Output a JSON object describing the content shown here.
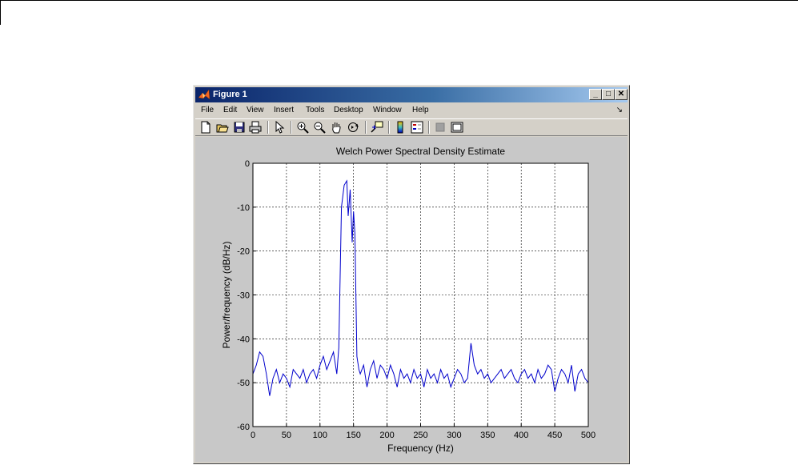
{
  "window": {
    "title": "Figure 1",
    "controls": {
      "minimize": "_",
      "maximize": "□",
      "close": "✕"
    }
  },
  "menu": [
    "File",
    "Edit",
    "View",
    "Insert",
    "Tools",
    "Desktop",
    "Window",
    "Help"
  ],
  "menu_overflow_icon": "arrow-icon",
  "toolbar": [
    "new-figure-icon",
    "open-file-icon",
    "save-icon",
    "print-icon",
    "select-arrow-icon",
    "zoom-in-icon",
    "zoom-out-icon",
    "pan-hand-icon",
    "rotate-3d-icon",
    "data-cursor-icon",
    "colorbar-icon",
    "legend-icon",
    "hide-plot-tools-icon",
    "show-plot-tools-icon"
  ],
  "colors": {
    "line": "#0000cc",
    "grid": "#000000",
    "title_gradient_start": "#0a246a",
    "title_gradient_end": "#a6caf0",
    "window_bg": "#d4d0c8",
    "figure_bg": "#c8c8c8"
  },
  "chart_data": {
    "type": "line",
    "title": "Welch Power Spectral Density Estimate",
    "xlabel": "Frequency (Hz)",
    "ylabel": "Power/frequency (dB/Hz)",
    "xlim": [
      0,
      500
    ],
    "ylim": [
      -60,
      0
    ],
    "xticks": [
      0,
      50,
      100,
      150,
      200,
      250,
      300,
      350,
      400,
      450,
      500
    ],
    "yticks": [
      0,
      -10,
      -20,
      -30,
      -40,
      -50,
      -60
    ],
    "grid": true,
    "series": [
      {
        "x": [
          0,
          5,
          10,
          15,
          20,
          25,
          30,
          35,
          40,
          45,
          50,
          55,
          60,
          65,
          70,
          75,
          80,
          85,
          90,
          95,
          100,
          105,
          110,
          115,
          120,
          125,
          128,
          132,
          136,
          140,
          142,
          145,
          148,
          150,
          152,
          155,
          158,
          160,
          165,
          170,
          175,
          180,
          185,
          190,
          195,
          200,
          205,
          210,
          215,
          220,
          225,
          230,
          235,
          240,
          245,
          250,
          255,
          260,
          265,
          270,
          275,
          280,
          285,
          290,
          295,
          300,
          305,
          310,
          315,
          320,
          325,
          330,
          335,
          340,
          345,
          350,
          355,
          360,
          365,
          370,
          375,
          380,
          385,
          390,
          395,
          400,
          405,
          410,
          415,
          420,
          425,
          430,
          435,
          440,
          445,
          450,
          455,
          460,
          465,
          470,
          475,
          480,
          485,
          490,
          495,
          500
        ],
        "y": [
          -48,
          -46,
          -43,
          -44,
          -48,
          -53,
          -49,
          -47,
          -50,
          -48,
          -49,
          -51,
          -47,
          -48,
          -49,
          -47,
          -50,
          -48,
          -47,
          -49,
          -46,
          -44,
          -47,
          -45,
          -43,
          -48,
          -42,
          -10,
          -5,
          -4,
          -12,
          -6,
          -18,
          -11,
          -16,
          -44,
          -47,
          -48,
          -46,
          -51,
          -47,
          -45,
          -49,
          -46,
          -47,
          -49,
          -46,
          -48,
          -51,
          -47,
          -49,
          -48,
          -50,
          -47,
          -49,
          -48,
          -51,
          -47,
          -49,
          -48,
          -50,
          -47,
          -49,
          -48,
          -51,
          -49,
          -47,
          -48,
          -50,
          -49,
          -41,
          -46,
          -48,
          -47,
          -49,
          -48,
          -50,
          -49,
          -48,
          -47,
          -49,
          -48,
          -47,
          -49,
          -50,
          -48,
          -47,
          -49,
          -48,
          -50,
          -47,
          -49,
          -48,
          -46,
          -47,
          -52,
          -49,
          -47,
          -48,
          -50,
          -46,
          -52,
          -48,
          -47,
          -49,
          -50
        ]
      }
    ]
  }
}
